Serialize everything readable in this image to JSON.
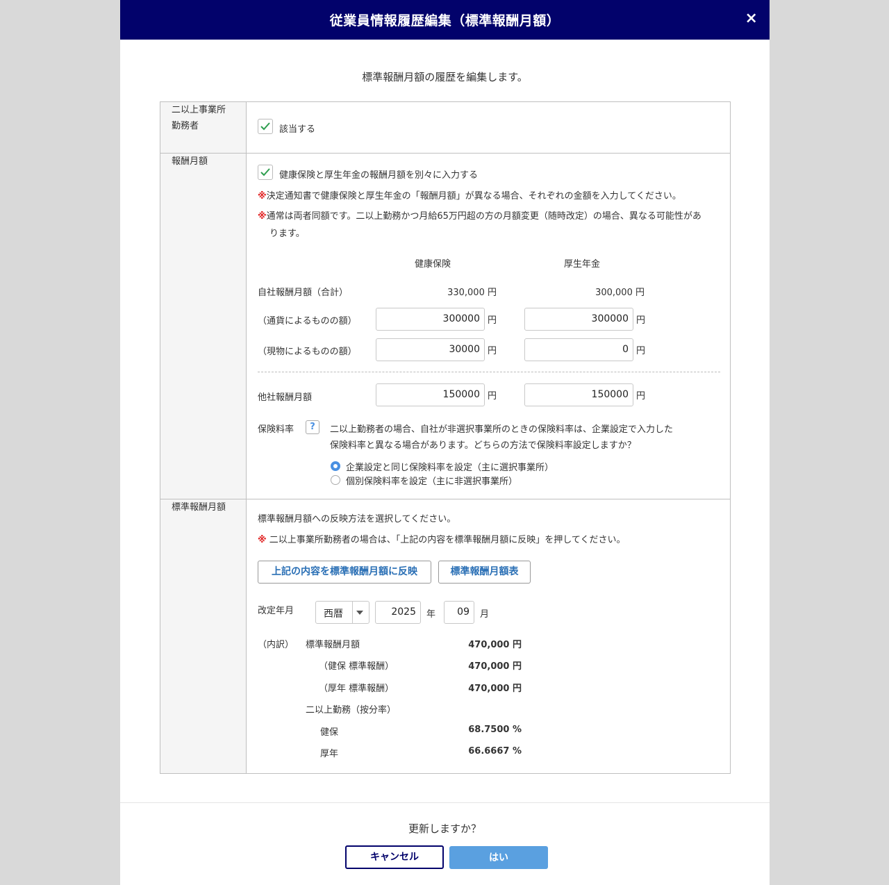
{
  "header": {
    "title": "従業員情報履歴編集（標準報酬月額）",
    "close": "×"
  },
  "subtitle": "標準報酬月額の履歴を編集します。",
  "row1": {
    "label_line1": "二以上事業所",
    "label_line2": "勤務者",
    "checkbox_label": "該当する"
  },
  "row2": {
    "label": "報酬月額",
    "separate_checkbox_label": "健康保険と厚生年金の報酬月額を別々に入力する",
    "note_mark": "※",
    "note1": "決定通知書で健康保険と厚生年金の「報酬月額」が異なる場合、それぞれの金額を入力してください。",
    "note2_line1": "通常は両者同額です。二以上勤務かつ月給65万円超の方の月額変更（随時改定）の場合、異なる可能性があ",
    "note2_line2": "ります。",
    "col_kenpo": "健康保険",
    "col_kosei": "厚生年金",
    "self_total_label": "自社報酬月額（合計）",
    "self_total_kenpo": "330,000 円",
    "self_total_kosei": "300,000 円",
    "currency_label": "（通貨によるものの額）",
    "currency_kenpo": "300000",
    "currency_kosei": "300000",
    "inkind_label": "（現物によるものの額）",
    "inkind_kenpo": "30000",
    "inkind_kosei": "0",
    "other_label": "他社報酬月額",
    "other_kenpo": "150000",
    "other_kosei": "150000",
    "yen": "円",
    "rate_label": "保険料率",
    "help": "?",
    "rate_text_line1": "二以上勤務者の場合、自社が非選択事業所のときの保険料率は、企業設定で入力した",
    "rate_text_line2": "保険料率と異なる場合があります。どちらの方法で保険料率設定しますか？",
    "radio1": "企業設定と同じ保険料率を設定（主に選択事業所）",
    "radio2": "個別保険料率を設定（主に非選択事業所）"
  },
  "row3": {
    "label": "標準報酬月額",
    "instruction": "標準報酬月額への反映方法を選択してください。",
    "note_mark": "※",
    "note": " 二以上事業所勤務者の場合は、「上記の内容を標準報酬月額に反映」を押してください。",
    "reflect_button": "上記の内容を標準報酬月額に反映",
    "table_button": "標準報酬月額表",
    "revision_label": "改定年月",
    "era_value": "西暦",
    "year_value": "2025",
    "year_unit": "年",
    "month_value": "09",
    "month_unit": "月",
    "breakdown_label": "（内訳）",
    "std_label": "標準報酬月額",
    "std_value": "470,000 円",
    "kenpo_std_label": "（健保 標準報酬）",
    "kenpo_std_value": "470,000 円",
    "kosei_std_label": "（厚年 標準報酬）",
    "kosei_std_value": "470,000 円",
    "multi_label": "二以上勤務（按分率）",
    "kenpo_label": "健保",
    "kenpo_rate": "68.7500 %",
    "kosei_label": "厚年",
    "kosei_rate": "66.6667 %"
  },
  "footer": {
    "confirm": "更新しますか？",
    "cancel": "キャンセル",
    "yes": "はい"
  },
  "colors": {
    "header_bg": "#02026b",
    "accent": "#4a90e2",
    "check": "#2e9e4f",
    "note_mark": "#e02020"
  }
}
